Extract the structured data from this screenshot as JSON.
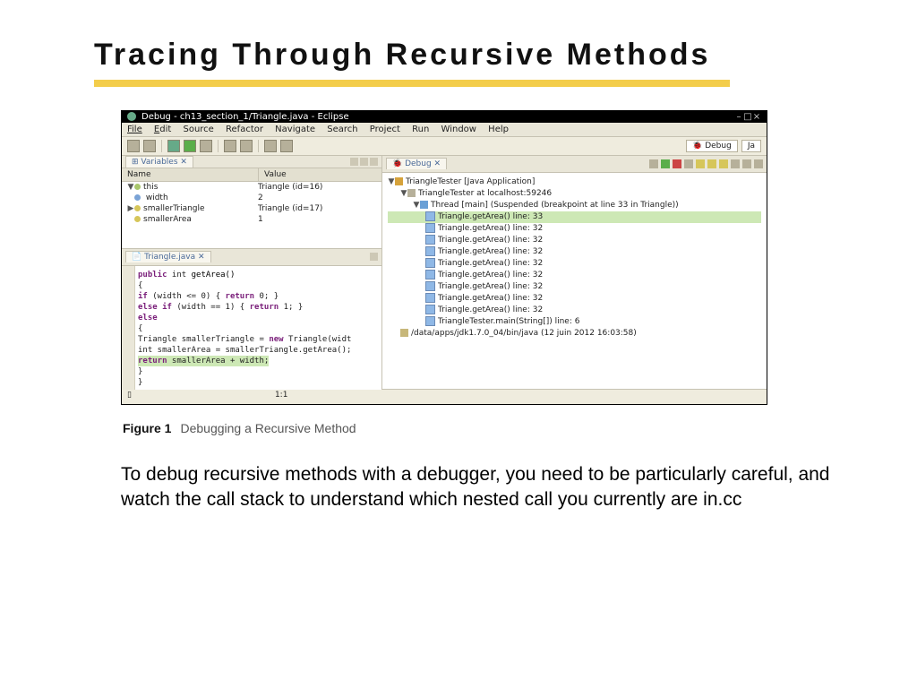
{
  "title": "Tracing Through Recursive Methods",
  "caption_label": "Figure 1",
  "caption_text": "Debugging a Recursive Method",
  "body_text": "To debug recursive methods with a debugger, you need to be particularly careful, and watch the call stack to understand which nested call you currently are in.cc",
  "ide": {
    "window_title": "Debug - ch13_section_1/Triangle.java - Eclipse",
    "menus": [
      "File",
      "Edit",
      "Source",
      "Refactor",
      "Navigate",
      "Search",
      "Project",
      "Run",
      "Window",
      "Help"
    ],
    "perspective_debug": "Debug",
    "perspective_java": "Ja",
    "vars_tab": "Variables",
    "vars_cols": {
      "name": "Name",
      "value": "Value"
    },
    "vars_rows": [
      {
        "tw": "▼",
        "dot": "dg",
        "name": "this",
        "value": "Triangle (id=16)"
      },
      {
        "tw": "",
        "dot": "db",
        "name": "   width",
        "value": "2"
      },
      {
        "tw": "▶",
        "dot": "dy",
        "name": "smallerTriangle",
        "value": "Triangle (id=17)"
      },
      {
        "tw": "",
        "dot": "dy",
        "name": "smallerArea",
        "value": "1"
      }
    ],
    "editor_tab": "Triangle.java",
    "code": {
      "l1a": "public",
      "l1b": " int ",
      "l1c": "getArea()",
      "l2": "{",
      "l3a": "   if",
      "l3b": " (width <= 0) { ",
      "l3c": "return",
      "l3d": " 0; }",
      "l4a": "   else if",
      "l4b": " (width == 1) { ",
      "l4c": "return",
      "l4d": " 1; }",
      "l5a": "   else",
      "l6": "   {",
      "l7a": "      Triangle smallerTriangle = ",
      "l7b": "new",
      "l7c": " Triangle(widt",
      "l8": "      int smallerArea = smallerTriangle.getArea();",
      "l9a": "      return",
      "l9b": " smallerArea + width;",
      "l10": "   }",
      "l11": "}"
    },
    "debug_tab": "Debug",
    "debug_tree": {
      "app": "TriangleTester [Java Application]",
      "host": "TriangleTester at localhost:59246",
      "thread": "Thread [main] (Suspended (breakpoint at line 33 in Triangle))",
      "frame_sel": "Triangle.getArea() line: 33",
      "frame32": "Triangle.getArea() line: 32",
      "frame_main": "TriangleTester.main(String[]) line: 6",
      "jvm": "/data/apps/jdk1.7.0_04/bin/java (12 juin 2012 16:03:58)"
    },
    "status_pos": "1:1"
  }
}
